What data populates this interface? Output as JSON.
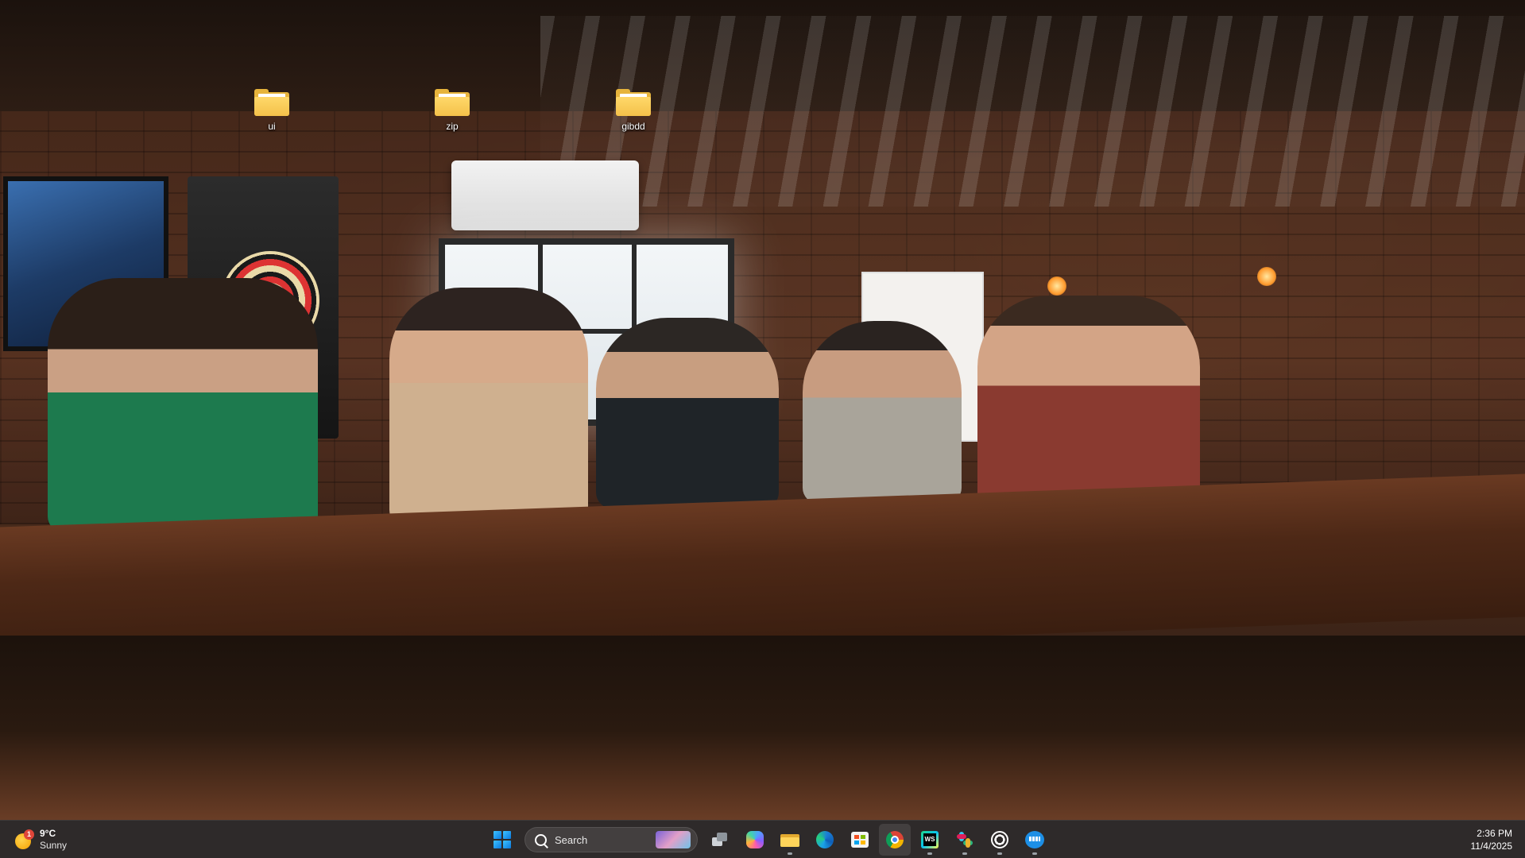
{
  "desktop": {
    "wallpaper": "bar-photo",
    "icons": [
      {
        "label": "ui",
        "icon": "folder-icon"
      },
      {
        "label": "zip",
        "icon": "folder-icon"
      },
      {
        "label": "gibdd",
        "icon": "folder-icon"
      }
    ]
  },
  "taskbar": {
    "weather": {
      "temp": "9°C",
      "condition": "Sunny",
      "badge": "1",
      "icon": "sun-icon"
    },
    "search": {
      "label": "Search"
    },
    "apps": [
      {
        "name": "start",
        "icon": "windows-start-icon"
      },
      {
        "name": "task-view",
        "icon": "task-view-icon"
      },
      {
        "name": "copilot",
        "icon": "copilot-icon"
      },
      {
        "name": "file-explorer",
        "icon": "folder-icon"
      },
      {
        "name": "edge",
        "icon": "edge-icon"
      },
      {
        "name": "store",
        "icon": "store-icon"
      },
      {
        "name": "chrome",
        "icon": "chrome-icon",
        "active": true
      },
      {
        "name": "webstorm",
        "icon": "webstorm-icon"
      },
      {
        "name": "slack",
        "icon": "slack-icon"
      },
      {
        "name": "chatgpt",
        "icon": "chatgpt-icon"
      },
      {
        "name": "docker",
        "icon": "docker-icon"
      }
    ],
    "clock": {
      "time": "2:36 PM",
      "date": "11/4/2025"
    }
  },
  "colors": {
    "taskbar_bg": "#1c1818",
    "folder": "#f4c14a",
    "active_indicator": "#5fb2ff"
  }
}
